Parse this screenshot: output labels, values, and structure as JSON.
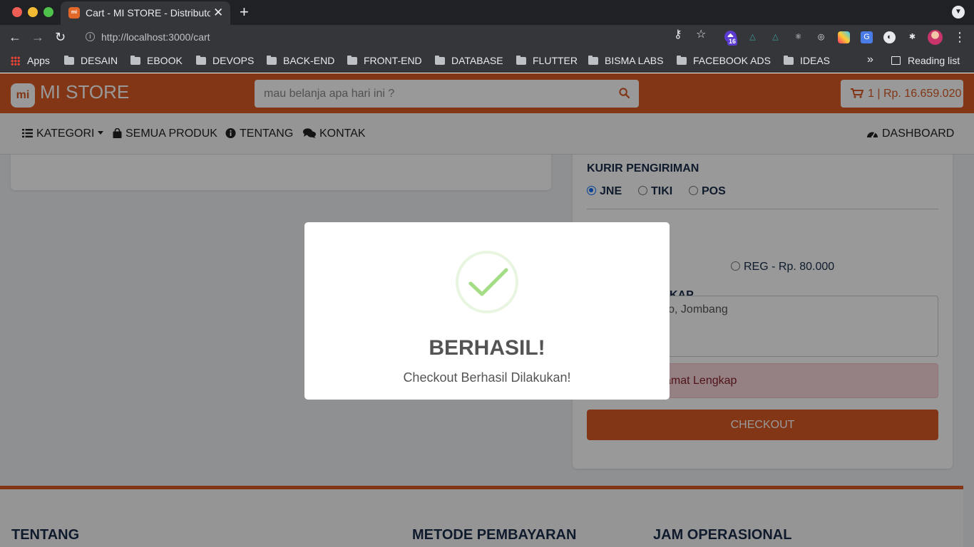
{
  "browser": {
    "tab_title": "Cart - MI STORE - Distributor",
    "tab_favicon": "mi",
    "url": "http://localhost:3000/cart",
    "extension_badge": "16",
    "bookmarks": [
      {
        "label": "Apps"
      },
      {
        "label": "DESAIN"
      },
      {
        "label": "EBOOK"
      },
      {
        "label": "DEVOPS"
      },
      {
        "label": "BACK-END"
      },
      {
        "label": "FRONT-END"
      },
      {
        "label": "DATABASE"
      },
      {
        "label": "FLUTTER"
      },
      {
        "label": "BISMA LABS"
      },
      {
        "label": "FACEBOOK ADS"
      },
      {
        "label": "IDEAS"
      }
    ],
    "more_bookmarks": "»",
    "reading_list": "Reading list"
  },
  "header": {
    "logo_mark": "mi",
    "logo_text": "MI STORE",
    "search_placeholder": "mau belanja apa hari ini ?",
    "cart_label": "1 | Rp. 16.659.020"
  },
  "nav": {
    "kategori": "KATEGORI",
    "semua_produk": "SEMUA PRODUK",
    "tentang": "TENTANG",
    "kontak": "KONTAK",
    "dashboard": "DASHBOARD"
  },
  "checkout_form": {
    "courier_label": "KURIR PENGIRIMAN",
    "couriers": [
      {
        "label": "JNE",
        "checked": true
      },
      {
        "label": "TIKI",
        "checked": false
      },
      {
        "label": "POS",
        "checked": false
      }
    ],
    "service_fragment": "000",
    "service_reg": "REG - Rp. 80.000",
    "address_label_fragment": "KAP",
    "address_value_fragment": "goro, Jombang",
    "alert_fragment": "amat Lengkap",
    "checkout_button": "CHECKOUT"
  },
  "footer": {
    "tentang": "TENTANG",
    "metode_pembayaran": "METODE PEMBAYARAN",
    "jam_operasional": "JAM OPERASIONAL"
  },
  "modal": {
    "title": "BERHASIL!",
    "message": "Checkout Berhasil Dilakukan!"
  },
  "colors": {
    "brand": "#d95a26",
    "success": "#a5dc86",
    "navy": "#1a2d4a"
  }
}
